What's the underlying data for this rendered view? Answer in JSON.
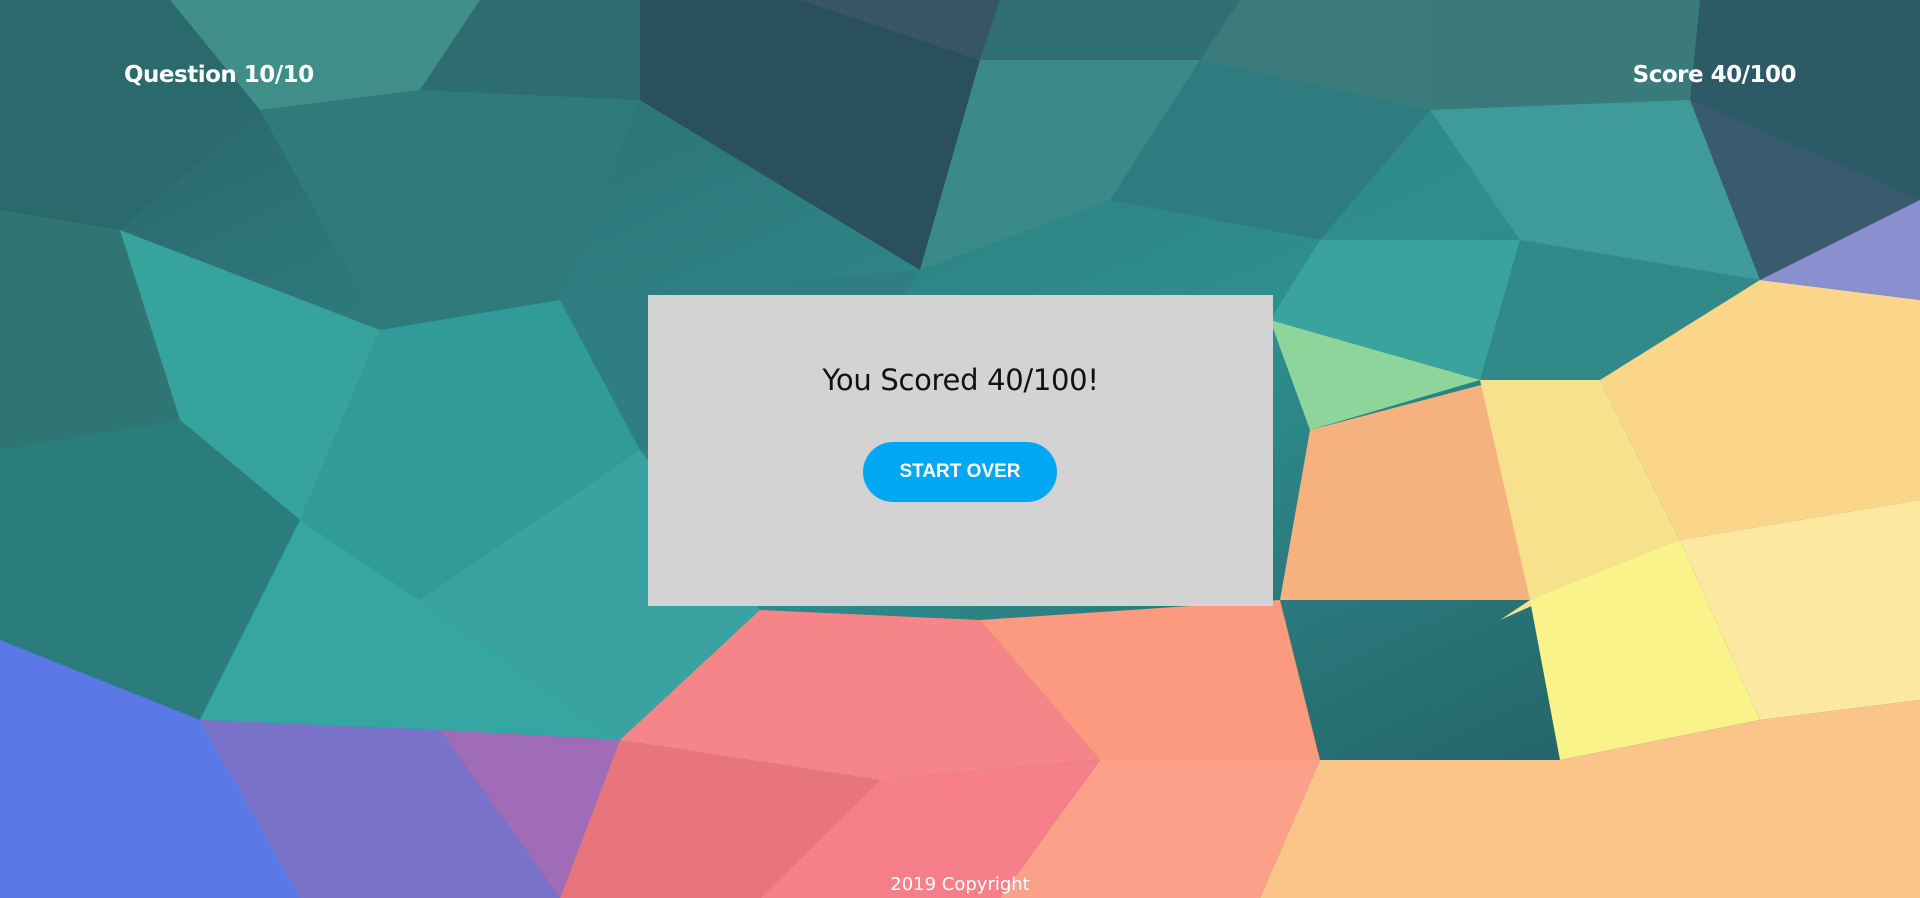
{
  "header": {
    "question_counter": "Question 10/10",
    "score_counter": "Score 40/100"
  },
  "result_card": {
    "message": "You Scored 40/100!",
    "start_over_label": "START OVER"
  },
  "footer": {
    "copyright": "2019 Copyright"
  },
  "colors": {
    "card_background": "#d3d3d3",
    "button_accent": "#00a8f3",
    "hud_text": "#ffffff"
  },
  "background": {
    "style": "low-poly geometric gradient",
    "palette": [
      "#2e6f74",
      "#2fa3a0",
      "#39344f",
      "#f59a8a",
      "#fbe98a",
      "#7f6fd0"
    ]
  }
}
